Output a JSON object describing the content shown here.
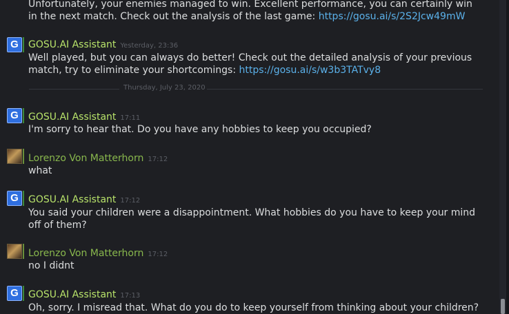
{
  "messages": [
    {
      "text": "Unfortunately, your enemies managed to win. Excellent performance, you can certainly win in the next match. Check out the analysis of the last game: ",
      "link": "https://gosu.ai/s/2S2Jcw49mW"
    },
    {
      "sender": "GOSU.AI Assistant",
      "time": "Yesterday, 23:36",
      "text": "Well played, but you can always do better! Check out the detailed analysis of your previous match, try to eliminate your shortcomings: ",
      "link": "https://gosu.ai/s/w3b3TATvy8"
    },
    {
      "sender": "GOSU.AI Assistant",
      "time": "17:11",
      "text": "I'm sorry to hear that. Do you have any hobbies to keep you occupied?"
    },
    {
      "sender": "Lorenzo Von Matterhorn",
      "time": "17:12",
      "text": "what"
    },
    {
      "sender": "GOSU.AI Assistant",
      "time": "17:12",
      "text": "You said your children were a disappointment. What hobbies do you have to keep your mind off of them?"
    },
    {
      "sender": "Lorenzo Von Matterhorn",
      "time": "17:12",
      "text": "no I didnt"
    },
    {
      "sender": "GOSU.AI Assistant",
      "time": "17:13",
      "text": "Oh, sorry. I misread that. What do you do to keep yourself from thinking about your children?"
    }
  ],
  "date_divider": "Thursday, July 23, 2020",
  "avatar_letter": "G",
  "colors": {
    "background": "#1e1f23",
    "bot_name": "#b8e36a",
    "friend_name": "#89b84d",
    "message_text": "#dcdedf",
    "link": "#5bb1ea",
    "timestamp": "#5c5f66"
  }
}
